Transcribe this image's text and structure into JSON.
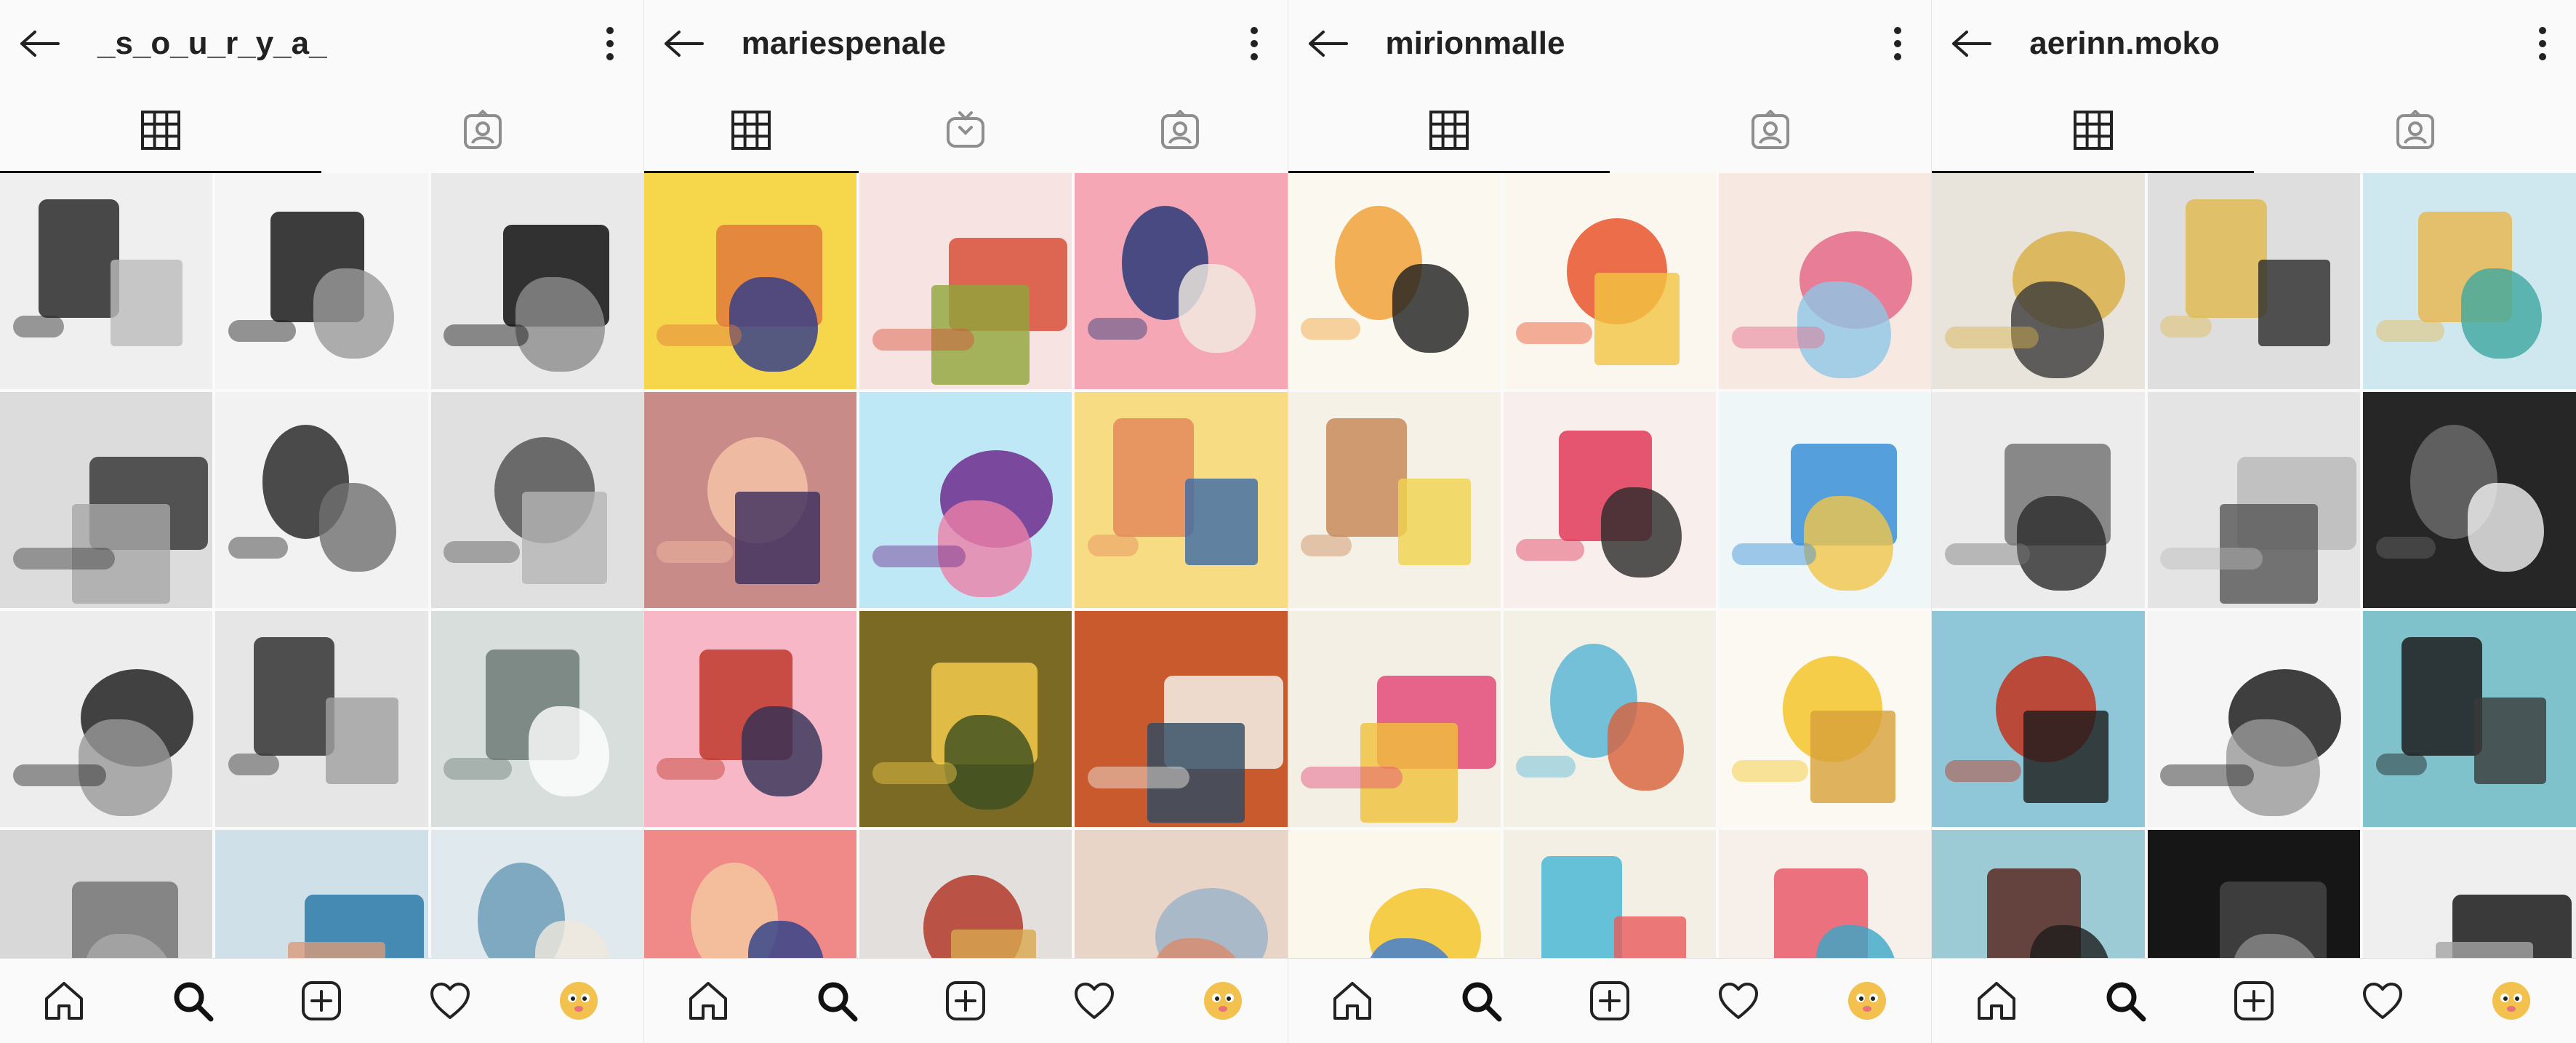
{
  "panels": [
    {
      "username": "_s_o_u_r_y_a_",
      "tabs": [
        "grid-icon",
        "tagged-icon"
      ],
      "posts": [
        {
          "bg": "#efefef",
          "a": "#2a2a2a",
          "b": "#bcbcbc"
        },
        {
          "bg": "#f5f5f5",
          "a": "#1b1b1b",
          "b": "#9a9a9a"
        },
        {
          "bg": "#e9e9e9",
          "a": "#101010",
          "b": "#8c8c8c"
        },
        {
          "bg": "#dcdcdc",
          "a": "#3a3a3a",
          "b": "#a8a8a8"
        },
        {
          "bg": "#f2f2f2",
          "a": "#2d2d2d",
          "b": "#6f6f6f"
        },
        {
          "bg": "#e0e0e0",
          "a": "#555555",
          "b": "#b5b5b5"
        },
        {
          "bg": "#ededed",
          "a": "#222222",
          "b": "#999999"
        },
        {
          "bg": "#e6e6e6",
          "a": "#333333",
          "b": "#a0a0a0"
        },
        {
          "bg": "#d7dedb",
          "a": "#6d7b76",
          "b": "#ffffff"
        },
        {
          "bg": "#d8d8d8",
          "a": "#777777",
          "b": "#a9a9a9"
        },
        {
          "bg": "#cfe0e8",
          "a": "#2b7aa8",
          "b": "#d99a7a"
        },
        {
          "bg": "#dfe9ee",
          "a": "#6f9db8",
          "b": "#f0e8dc"
        }
      ]
    },
    {
      "username": "mariespenale",
      "tabs": [
        "grid-icon",
        "igtv-icon",
        "tagged-icon"
      ],
      "posts": [
        {
          "bg": "#f6d64a",
          "a": "#e07a3c",
          "b": "#2d3a8c"
        },
        {
          "bg": "#f7e3e2",
          "a": "#d8503a",
          "b": "#8fa53b"
        },
        {
          "bg": "#f6a7b5",
          "a": "#2b3a7a",
          "b": "#f2ede2"
        },
        {
          "bg": "#c98b88",
          "a": "#f4c2a7",
          "b": "#3b2d5e"
        },
        {
          "bg": "#bfe8f6",
          "a": "#6d2c8c",
          "b": "#ec7fa8"
        },
        {
          "bg": "#f7dc84",
          "a": "#e58a5b",
          "b": "#3a6aa8"
        },
        {
          "bg": "#f7b7c6",
          "a": "#c0392b",
          "b": "#2f2f55"
        },
        {
          "bg": "#7a6a24",
          "a": "#f2c94c",
          "b": "#3b4d1f"
        },
        {
          "bg": "#c85a2e",
          "a": "#f5f1e8",
          "b": "#2c4a63"
        },
        {
          "bg": "#f08a88",
          "a": "#f4c7a0",
          "b": "#2a3e8a"
        },
        {
          "bg": "#e3dfdc",
          "a": "#b33a2a",
          "b": "#d8a84f"
        },
        {
          "bg": "#e9d4c8",
          "a": "#9fb4c8",
          "b": "#d98a6a"
        }
      ]
    },
    {
      "username": "mirionmalle",
      "tabs": [
        "grid-icon",
        "tagged-icon"
      ],
      "posts": [
        {
          "bg": "#fbf8ef",
          "a": "#f0a23a",
          "b": "#1e1e1e"
        },
        {
          "bg": "#fbf6ee",
          "a": "#e8552b",
          "b": "#f2c542"
        },
        {
          "bg": "#f8e8e2",
          "a": "#e46a8a",
          "b": "#8fc7e6"
        },
        {
          "bg": "#f6f1e6",
          "a": "#c98b5a",
          "b": "#f0d34d"
        },
        {
          "bg": "#f8efec",
          "a": "#e23a5a",
          "b": "#2a2a2a"
        },
        {
          "bg": "#eef6f8",
          "a": "#3a8fd8",
          "b": "#f1c64a"
        },
        {
          "bg": "#f4efe5",
          "a": "#e34b7a",
          "b": "#f0c03a"
        },
        {
          "bg": "#f3f0e6",
          "a": "#5db7d6",
          "b": "#d8603a"
        },
        {
          "bg": "#fbf9f1",
          "a": "#f3c62c",
          "b": "#d8a03a"
        },
        {
          "bg": "#fbf7ea",
          "a": "#f3c62c",
          "b": "#3a7ad8"
        },
        {
          "bg": "#f3efe4",
          "a": "#4bb8d6",
          "b": "#e85a5a"
        },
        {
          "bg": "#f7f0ea",
          "a": "#e85b6a",
          "b": "#3aa7c8"
        }
      ]
    },
    {
      "username": "aerinn.moko",
      "tabs": [
        "grid-icon",
        "tagged-icon"
      ],
      "posts": [
        {
          "bg": "#e8e4dc",
          "a": "#d9b24a",
          "b": "#3a3a3a"
        },
        {
          "bg": "#dedede",
          "a": "#e0bb55",
          "b": "#2a2a2a"
        },
        {
          "bg": "#cfe7ee",
          "a": "#e7b955",
          "b": "#3ea8a0"
        },
        {
          "bg": "#ececec",
          "a": "#777777",
          "b": "#2c2c2c"
        },
        {
          "bg": "#e4e4e4",
          "a": "#bbbbbb",
          "b": "#555555"
        },
        {
          "bg": "#262626",
          "a": "#6a6a6a",
          "b": "#f2f2f2"
        },
        {
          "bg": "#8fc7d8",
          "a": "#c2331e",
          "b": "#1b1b1b"
        },
        {
          "bg": "#f5f5f5",
          "a": "#1f1f1f",
          "b": "#9a9a9a"
        },
        {
          "bg": "#7fc2cc",
          "a": "#1d1d1d",
          "b": "#3a3a3a"
        },
        {
          "bg": "#9ccbd6",
          "a": "#5a2a22",
          "b": "#1d1d1d"
        },
        {
          "bg": "#161616",
          "a": "#444444",
          "b": "#8a8a8a"
        },
        {
          "bg": "#efefef",
          "a": "#1a1a1a",
          "b": "#a5a5a5"
        }
      ]
    }
  ],
  "bottom_nav": [
    "home-icon",
    "search-icon",
    "add-post-icon",
    "heart-icon",
    "profile-avatar"
  ]
}
